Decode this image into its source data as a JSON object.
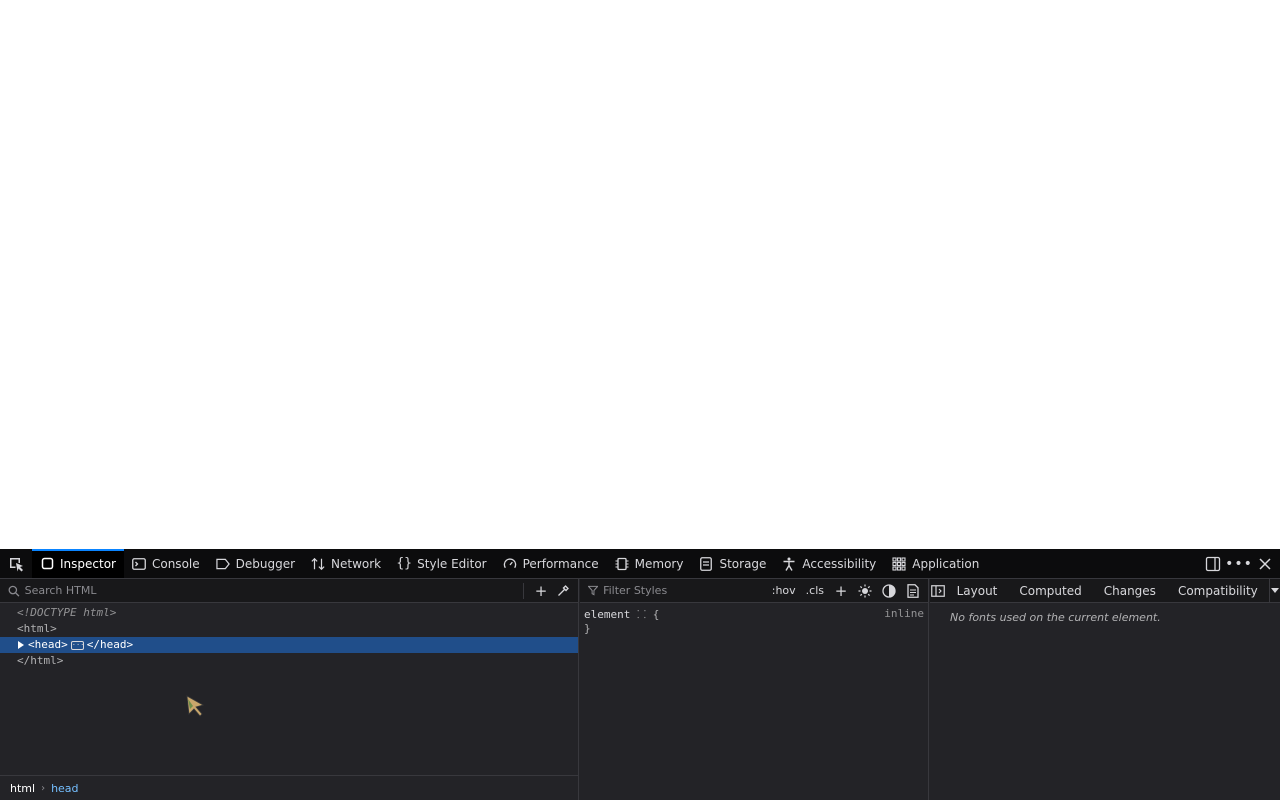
{
  "toolbar": {
    "tabs": [
      {
        "label": "Inspector",
        "icon": "inspector-icon"
      },
      {
        "label": "Console",
        "icon": "console-icon"
      },
      {
        "label": "Debugger",
        "icon": "debugger-icon"
      },
      {
        "label": "Network",
        "icon": "network-icon"
      },
      {
        "label": "Style Editor",
        "icon": "style-editor-icon"
      },
      {
        "label": "Performance",
        "icon": "performance-icon"
      },
      {
        "label": "Memory",
        "icon": "memory-icon"
      },
      {
        "label": "Storage",
        "icon": "storage-icon"
      },
      {
        "label": "Accessibility",
        "icon": "accessibility-icon"
      },
      {
        "label": "Application",
        "icon": "application-icon"
      }
    ],
    "active_tab": "Inspector",
    "accent_color": "#0a84ff"
  },
  "markup": {
    "search_placeholder": "Search HTML",
    "rows": {
      "doctype": "<!DOCTYPE html>",
      "html_open": "<html>",
      "head_open": "<head>",
      "head_close": "</head>",
      "html_close": "</html>"
    },
    "selected_color": "#204e8a"
  },
  "breadcrumbs": {
    "items": [
      "html",
      "head"
    ]
  },
  "rules": {
    "filter_placeholder": "Filter Styles",
    "hov_label": ":hov",
    "cls_label": ".cls",
    "element_rule": "element ",
    "brace_open": "{",
    "brace_close": "}",
    "source": "inline"
  },
  "sidebar": {
    "tabs": [
      "Layout",
      "Computed",
      "Changes",
      "Compatibility"
    ],
    "fonts_message": "No fonts used on the current element."
  }
}
